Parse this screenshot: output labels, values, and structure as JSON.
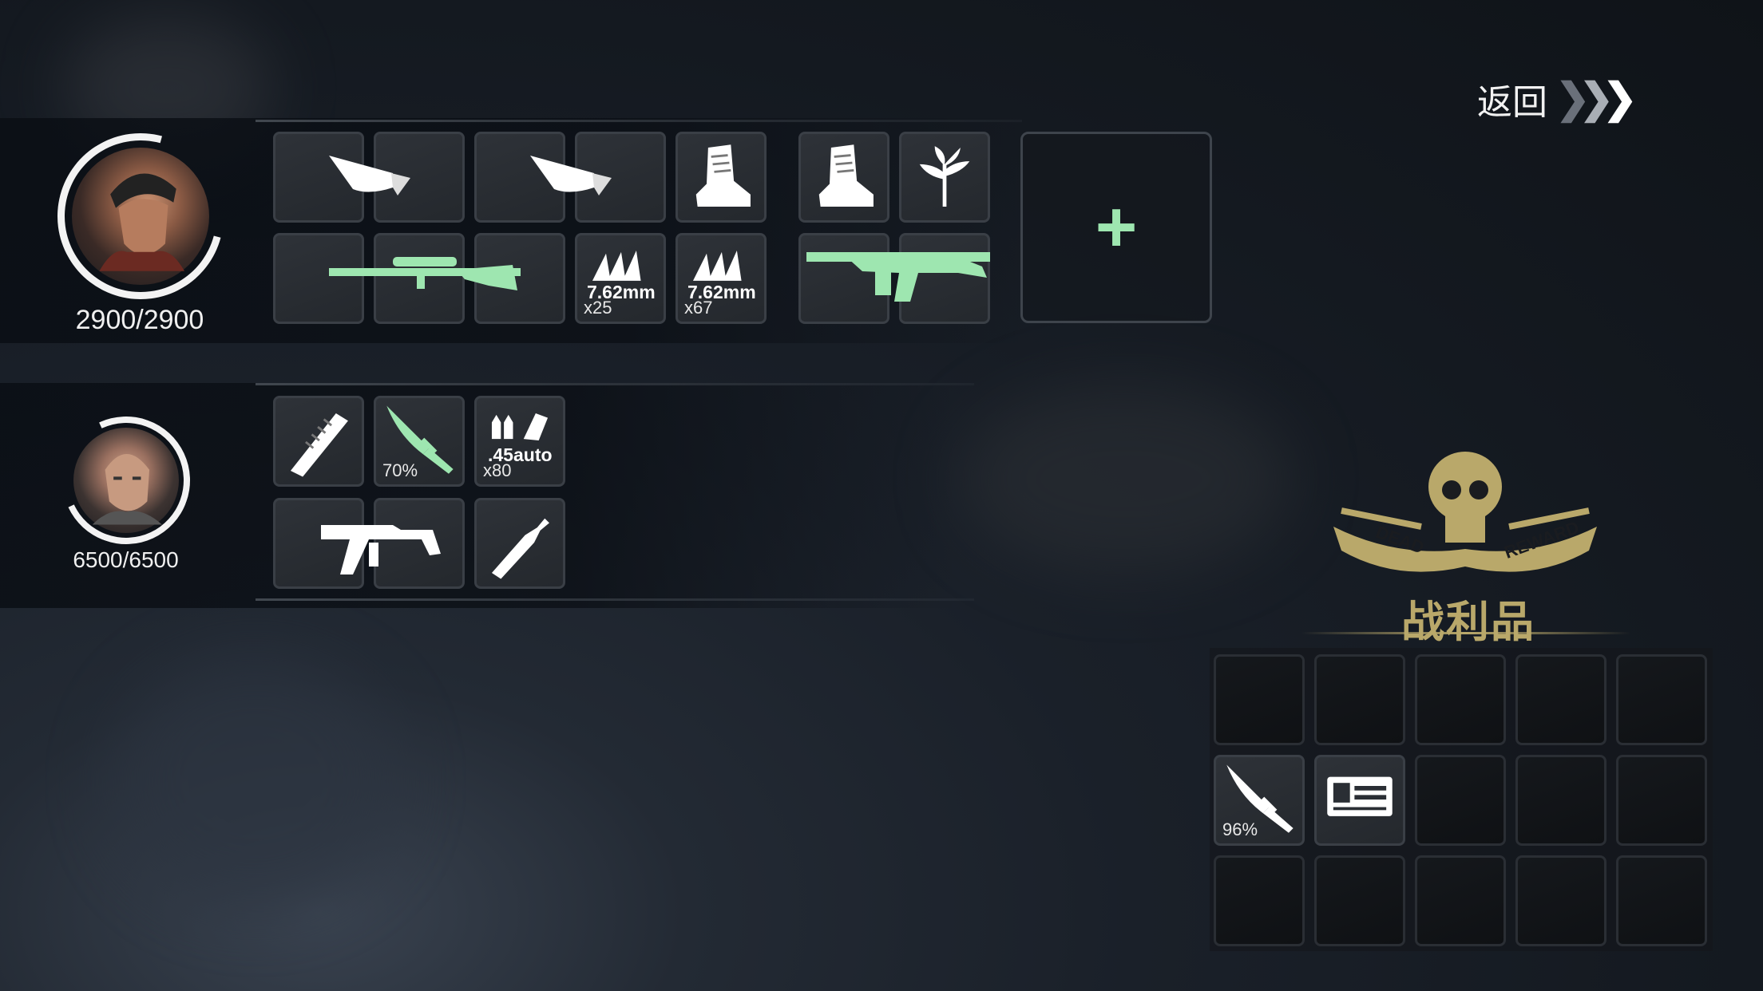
{
  "nav": {
    "back_label": "返回",
    "back_chevrons": "❯❯❯"
  },
  "characters": [
    {
      "hp": "2900/2900",
      "portrait": "male-survivor-portrait",
      "items": [
        {
          "icon": "torso-armor-icon"
        },
        {
          "icon": "leg-armor-icon"
        },
        {
          "icon": "boot-icon"
        },
        {
          "icon": "sniper-rifle-icon",
          "tint": "#9ee6b0"
        },
        {
          "icon": "ammo-icon",
          "caliber": "7.62mm",
          "qty": "x25"
        },
        {
          "icon": "ammo-icon",
          "caliber": "7.62mm",
          "qty": "x67"
        },
        {
          "icon": "boot-icon"
        },
        {
          "icon": "herb-icon"
        },
        {
          "icon": "assault-rifle-icon",
          "tint": "#9ee6b0"
        }
      ],
      "add_slot": "+"
    },
    {
      "hp": "6500/6500",
      "portrait": "old-man-portrait",
      "items": [
        {
          "icon": "brush-icon"
        },
        {
          "icon": "knife-icon",
          "tint": "#9ee6b0",
          "durability": "70%"
        },
        {
          "icon": "ammo-icon",
          "caliber": ".45auto",
          "qty": "x80"
        },
        {
          "icon": "smg-icon"
        },
        {
          "icon": "bottle-icon"
        }
      ]
    }
  ],
  "loot": {
    "emblem": "dead-reward-skull-emblem",
    "emblem_text_left": "DEAD",
    "emblem_text_right": "REWARD",
    "title": "战利品",
    "slots": [
      {},
      {},
      {},
      {},
      {},
      {
        "icon": "knife-icon",
        "durability": "96%"
      },
      {
        "icon": "id-card-icon"
      },
      {},
      {},
      {},
      {},
      {},
      {},
      {},
      {}
    ]
  },
  "colors": {
    "accent_green": "#9ee6b0",
    "loot_gold": "#b9a86a"
  }
}
